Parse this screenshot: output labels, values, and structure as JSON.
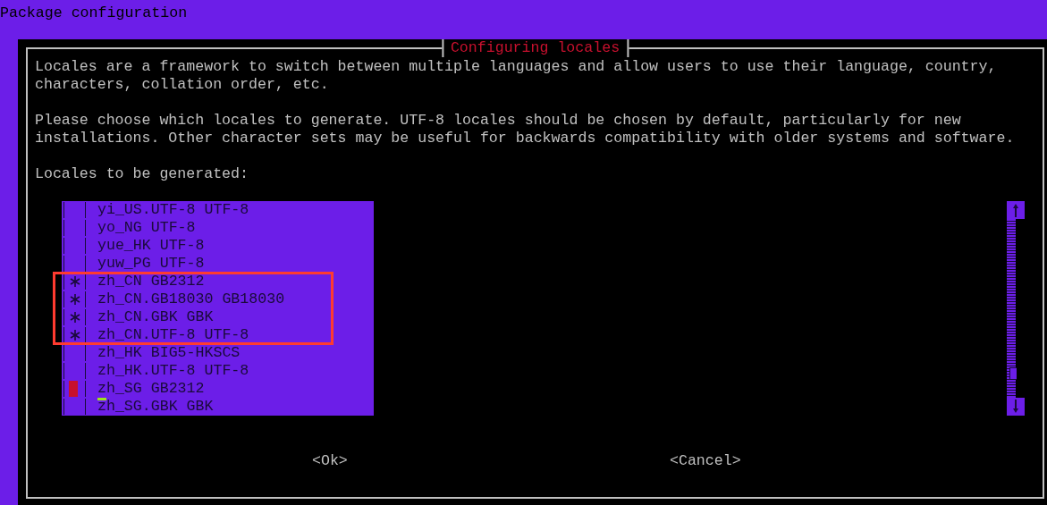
{
  "window": {
    "title": "Package configuration"
  },
  "dialog": {
    "title": "Configuring locales",
    "paragraphs": [
      {
        "lines": [
          "Locales are a framework to switch between multiple languages and allow users to use their language, country,",
          "characters, collation order, etc."
        ]
      },
      {
        "lines": [
          "Please choose which locales to generate. UTF-8 locales should be chosen by default, particularly for new",
          "installations. Other character sets may be useful for backwards compatibility with older systems and software."
        ]
      },
      {
        "lines": [
          "Locales to be generated:"
        ]
      }
    ],
    "items": [
      {
        "label": "yi_US.UTF-8 UTF-8",
        "checked": false,
        "focused": false,
        "highlighted": false
      },
      {
        "label": "yo_NG UTF-8",
        "checked": false,
        "focused": false,
        "highlighted": false
      },
      {
        "label": "yue_HK UTF-8",
        "checked": false,
        "focused": false,
        "highlighted": false
      },
      {
        "label": "yuw_PG UTF-8",
        "checked": false,
        "focused": false,
        "highlighted": false
      },
      {
        "label": "zh_CN GB2312",
        "checked": true,
        "focused": false,
        "highlighted": true
      },
      {
        "label": "zh_CN.GB18030 GB18030",
        "checked": true,
        "focused": false,
        "highlighted": true
      },
      {
        "label": "zh_CN.GBK GBK",
        "checked": true,
        "focused": false,
        "highlighted": true
      },
      {
        "label": "zh_CN.UTF-8 UTF-8",
        "checked": true,
        "focused": false,
        "highlighted": true
      },
      {
        "label": "zh_HK BIG5-HKSCS",
        "checked": false,
        "focused": false,
        "highlighted": false
      },
      {
        "label": "zh_HK.UTF-8 UTF-8",
        "checked": false,
        "focused": false,
        "highlighted": false
      },
      {
        "label": "zh_SG GB2312",
        "checked": false,
        "focused": true,
        "highlighted": false
      },
      {
        "label": "zh_SG.GBK GBK",
        "checked": false,
        "focused": false,
        "highlighted": false
      }
    ],
    "buttons": [
      {
        "label": "<Ok>"
      },
      {
        "label": "<Cancel>"
      }
    ]
  }
}
